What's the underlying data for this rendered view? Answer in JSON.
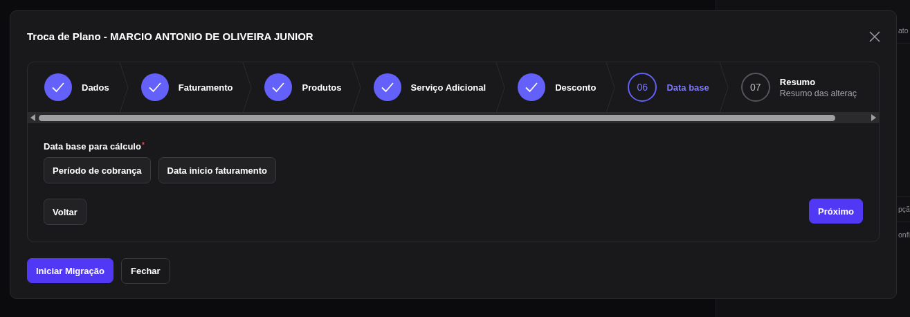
{
  "background": {
    "texts": [
      "ato",
      "pçã",
      "onfi"
    ]
  },
  "dialog": {
    "title": "Troca de Plano - MARCIO ANTONIO DE OLIVEIRA JUNIOR",
    "steps": [
      {
        "label": "Dados",
        "completed": true
      },
      {
        "label": "Faturamento",
        "completed": true
      },
      {
        "label": "Produtos",
        "completed": true
      },
      {
        "label": "Serviço Adicional",
        "completed": true
      },
      {
        "label": "Desconto",
        "completed": true
      },
      {
        "number": "06",
        "label": "Data base",
        "completed": false,
        "active": true
      },
      {
        "number": "07",
        "label": "Resumo",
        "subtitle": "Resumo das alteraç",
        "completed": false,
        "active": false
      }
    ],
    "field": {
      "label": "Data base para cálculo",
      "required_mark": "*",
      "options": [
        {
          "label": "Período de cobrança",
          "selected": false
        },
        {
          "label": "Data inicio faturamento",
          "selected": false
        }
      ]
    },
    "back_button": "Voltar",
    "next_button": "Próximo",
    "footer_buttons": [
      {
        "label": "Iniciar Migração",
        "kind": "primary"
      },
      {
        "label": "Fechar",
        "kind": "secondary"
      }
    ]
  }
}
